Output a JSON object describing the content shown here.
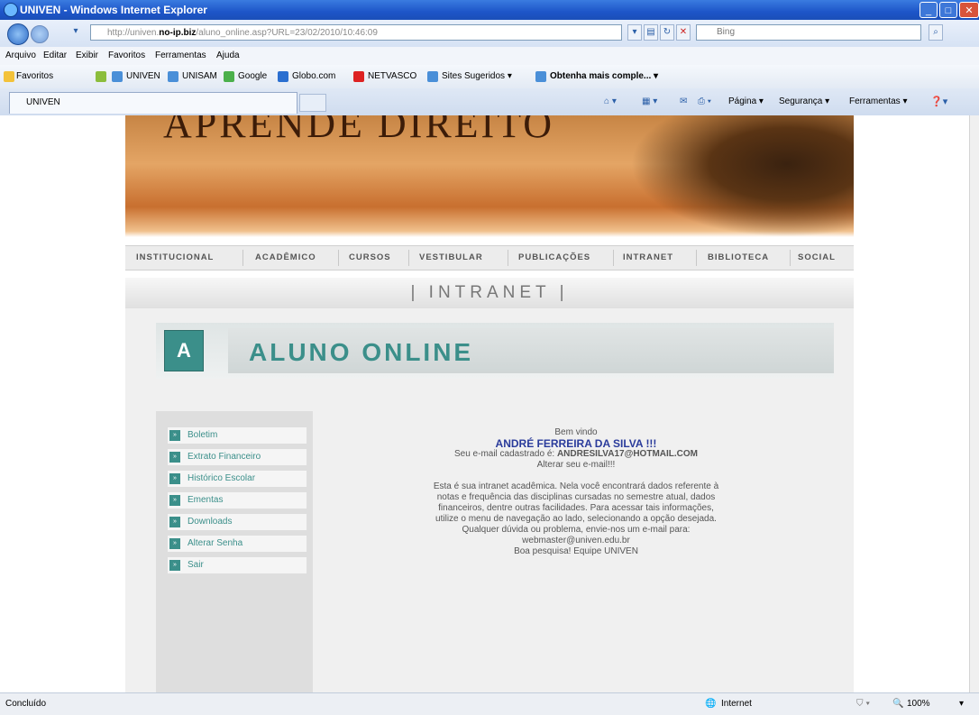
{
  "window": {
    "title": "UNIVEN - Windows Internet Explorer"
  },
  "addressbar": {
    "url_prefix": "http://univen.",
    "url_domain": "no-ip.biz",
    "url_rest": "/aluno_online.asp?URL=23/02/2010/10:46:09",
    "search_placeholder": "Bing"
  },
  "menubar": [
    "Arquivo",
    "Editar",
    "Exibir",
    "Favoritos",
    "Ferramentas",
    "Ajuda"
  ],
  "favorites": {
    "label": "Favoritos",
    "items": [
      "UNIVEN",
      "UNISAM",
      "Google",
      "Globo.com",
      "NETVASCO",
      "Sites Sugeridos ▾",
      "Obtenha mais comple... ▾"
    ]
  },
  "tab": {
    "label": "UNIVEN"
  },
  "commandbar": [
    "Página ▾",
    "Segurança ▾",
    "Ferramentas ▾"
  ],
  "banner": {
    "text": "APRENDE DIREITO"
  },
  "nav": [
    "INSTITUCIONAL",
    "ACADÊMICO",
    "CURSOS",
    "VESTIBULAR",
    "PUBLICAÇÕES",
    "INTRANET",
    "BIBLIOTECA",
    "SOCIAL"
  ],
  "section_header": "| INTRANET |",
  "aluno": {
    "icon_letter": "A",
    "title": "ALUNO ONLINE"
  },
  "sidebar": {
    "items": [
      "Boletim",
      "Extrato Financeiro",
      "Histórico Escolar",
      "Ementas",
      "Downloads",
      "Alterar Senha",
      "Sair"
    ]
  },
  "welcome": {
    "greeting": "Bem vindo",
    "name": "ANDRÉ FERREIRA DA SILVA !!!",
    "email_line_prefix": "Seu e-mail cadastrado é:",
    "email": "ANDRESILVA17@HOTMAIL.COM",
    "change_email": "Alterar seu e-mail!!!",
    "p1": "Esta é sua intranet acadêmica. Nela você encontrará dados referente à",
    "p2": "notas e frequência das disciplinas cursadas no semestre atual, dados",
    "p3": "financeiros, dentre outras facilidades. Para acessar tais informações,",
    "p4": "utilize o menu de navegação ao lado, selecionando a opção desejada.",
    "p5": "Qualquer dúvida ou problema, envie-nos um e-mail para:",
    "p6": "webmaster@univen.edu.br",
    "p7": "Boa pesquisa! Equipe UNIVEN"
  },
  "statusbar": {
    "left": "Concluído",
    "zone": "Internet",
    "zoom": "100%"
  }
}
